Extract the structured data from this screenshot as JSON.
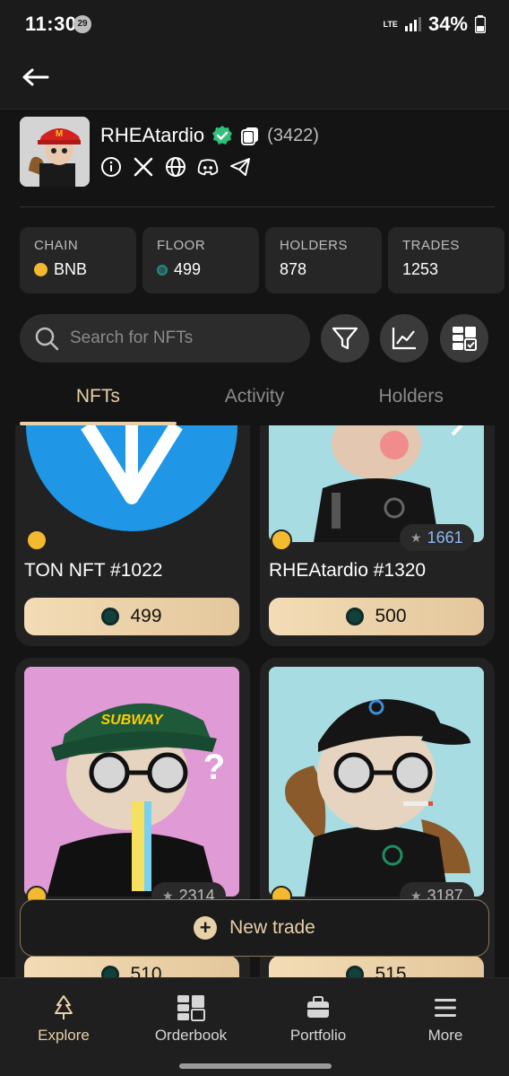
{
  "status_bar": {
    "time": "11:30",
    "notif_count": "29",
    "network": "LTE",
    "battery": "34%"
  },
  "collection": {
    "name": "RHEAtardio",
    "count": "(3422)",
    "stats": [
      {
        "label": "CHAIN",
        "value": "BNB",
        "icon": "bnb-coin-icon"
      },
      {
        "label": "FLOOR",
        "value": "499",
        "icon": "ton-coin-icon"
      },
      {
        "label": "HOLDERS",
        "value": "878"
      },
      {
        "label": "TRADES",
        "value": "1253"
      }
    ]
  },
  "search": {
    "placeholder": "Search for NFTs"
  },
  "tabs": [
    {
      "label": "NFTs"
    },
    {
      "label": "Activity"
    },
    {
      "label": "Holders"
    }
  ],
  "nfts": [
    {
      "title": "TON NFT #1022",
      "price": "499"
    },
    {
      "title": "RHEAtardio #1320",
      "price": "500",
      "rank": "1661"
    },
    {
      "title": "",
      "price": "510",
      "rank": "2314"
    },
    {
      "title": "",
      "price": "515",
      "rank": "3187"
    }
  ],
  "new_trade": {
    "label": "New trade"
  },
  "bottom_nav": [
    {
      "label": "Explore",
      "icon": "tree-icon"
    },
    {
      "label": "Orderbook",
      "icon": "orderbook-icon"
    },
    {
      "label": "Portfolio",
      "icon": "briefcase-icon"
    },
    {
      "label": "More",
      "icon": "menu-icon"
    }
  ],
  "colors": {
    "accent": "#e8d0a8",
    "background": "#141414",
    "card": "#222222",
    "bnb": "#f3ba2f"
  }
}
